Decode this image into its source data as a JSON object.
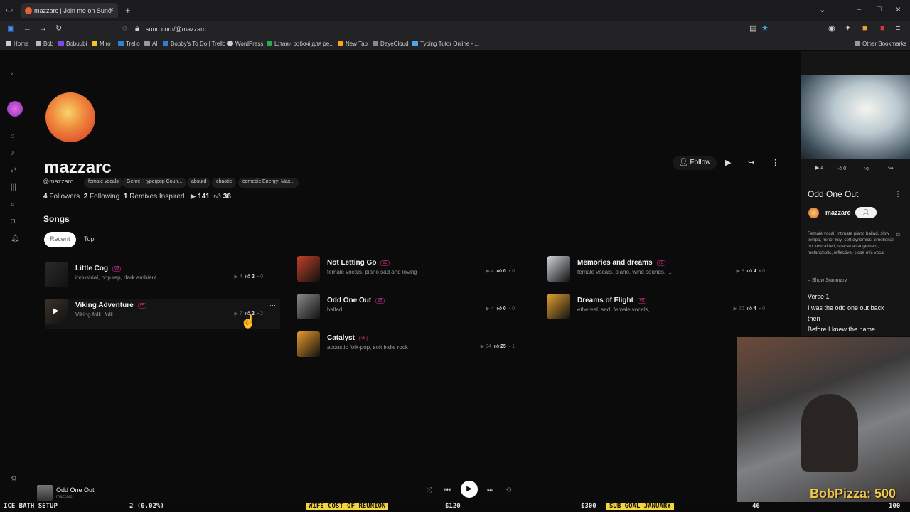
{
  "browser": {
    "tab_title": "mazzarc | Join me on Suno",
    "url": "suno.com/@mazzarc",
    "bookmarks": [
      "Home",
      "Bob",
      "Bobuubi",
      "Miro",
      "Trello",
      "AI",
      "Bobby's To Do | Trello",
      "WordPress",
      "Штани робочі для ре...",
      "New Tab",
      "DeyeCloud",
      "Typing Tutor Online - ..."
    ],
    "other_bookmarks": "Other Bookmarks"
  },
  "profile": {
    "name": "mazzarc",
    "handle": "@mazzarc",
    "tags": [
      "female vocals",
      "Genre: Hyperpop Coun...",
      "absurd",
      "chaotic",
      "comedic Energy: Max..."
    ],
    "followers_count": "4",
    "followers_label": "Followers",
    "following_count": "2",
    "following_label": "Following",
    "remixes_count": "1",
    "remixes_label": "Remixes Inspired",
    "plays": "141",
    "likes": "36",
    "follow_label": "Follow"
  },
  "songs": {
    "heading": "Songs",
    "filters": [
      "Recent",
      "Top"
    ],
    "version_badge": "v5",
    "items": [
      {
        "title": "Little Cog",
        "desc": "industrial, pop rap, dark ambient",
        "plays": "4",
        "likes": "2",
        "comments": "0",
        "color": "#2a2a2a"
      },
      {
        "title": "Viking Adventure",
        "desc": "Viking folk, folk",
        "plays": "7",
        "likes": "2",
        "comments": "2",
        "color": "#3a3228"
      },
      {
        "title": "Not Letting Go",
        "desc": "female vocals, piano sad and loving",
        "plays": "4",
        "likes": "0",
        "comments": "0",
        "color": "#c2402a"
      },
      {
        "title": "Odd One Out",
        "desc": "ballad",
        "plays": "4",
        "likes": "0",
        "comments": "0",
        "color": "#8a8a8a"
      },
      {
        "title": "Catalyst",
        "desc": "acoustic folk-pop, soft indie rock",
        "plays": "94",
        "likes": "25",
        "comments": "1",
        "color": "#e79a2a"
      },
      {
        "title": "Memories and dreams",
        "desc": "female vocals, piano, wind sounds, ...",
        "plays": "8",
        "likes": "4",
        "comments": "0",
        "color": "#cfd4d8"
      },
      {
        "title": "Dreams of Flight",
        "desc": "ethereal, sad, female vocals, ...",
        "plays": "20",
        "likes": "4",
        "comments": "0",
        "color": "#e0a030"
      }
    ]
  },
  "right_panel": {
    "stats": {
      "plays": "4",
      "likes": "0"
    },
    "title": "Odd One Out",
    "artist": "mazzarc",
    "description": "Female vocal, intimate piano ballad, slow tempo, minor key, soft dynamics, emotional but restrained, sparse arrangement, melancholic, reflective, close mic vocal",
    "summary_link": "– Show Summary",
    "lyrics": [
      "Verse 1",
      "I was the odd one out back",
      "then",
      "Before I knew the name"
    ]
  },
  "player": {
    "title": "Odd One Out",
    "artist": "mazzarc"
  },
  "stream_overlay": {
    "donation": "BobPizza: 500"
  },
  "ticker": {
    "items": [
      "ICE BATH SETUP",
      "2 (0.02%)",
      "WIFE COST OF REUNION",
      "$120",
      "$300",
      "SUB GOAL JANUARY",
      "46",
      "100"
    ]
  },
  "colors": {
    "accent": "#e0308e",
    "ticker_highlight": "#f3d43c"
  }
}
